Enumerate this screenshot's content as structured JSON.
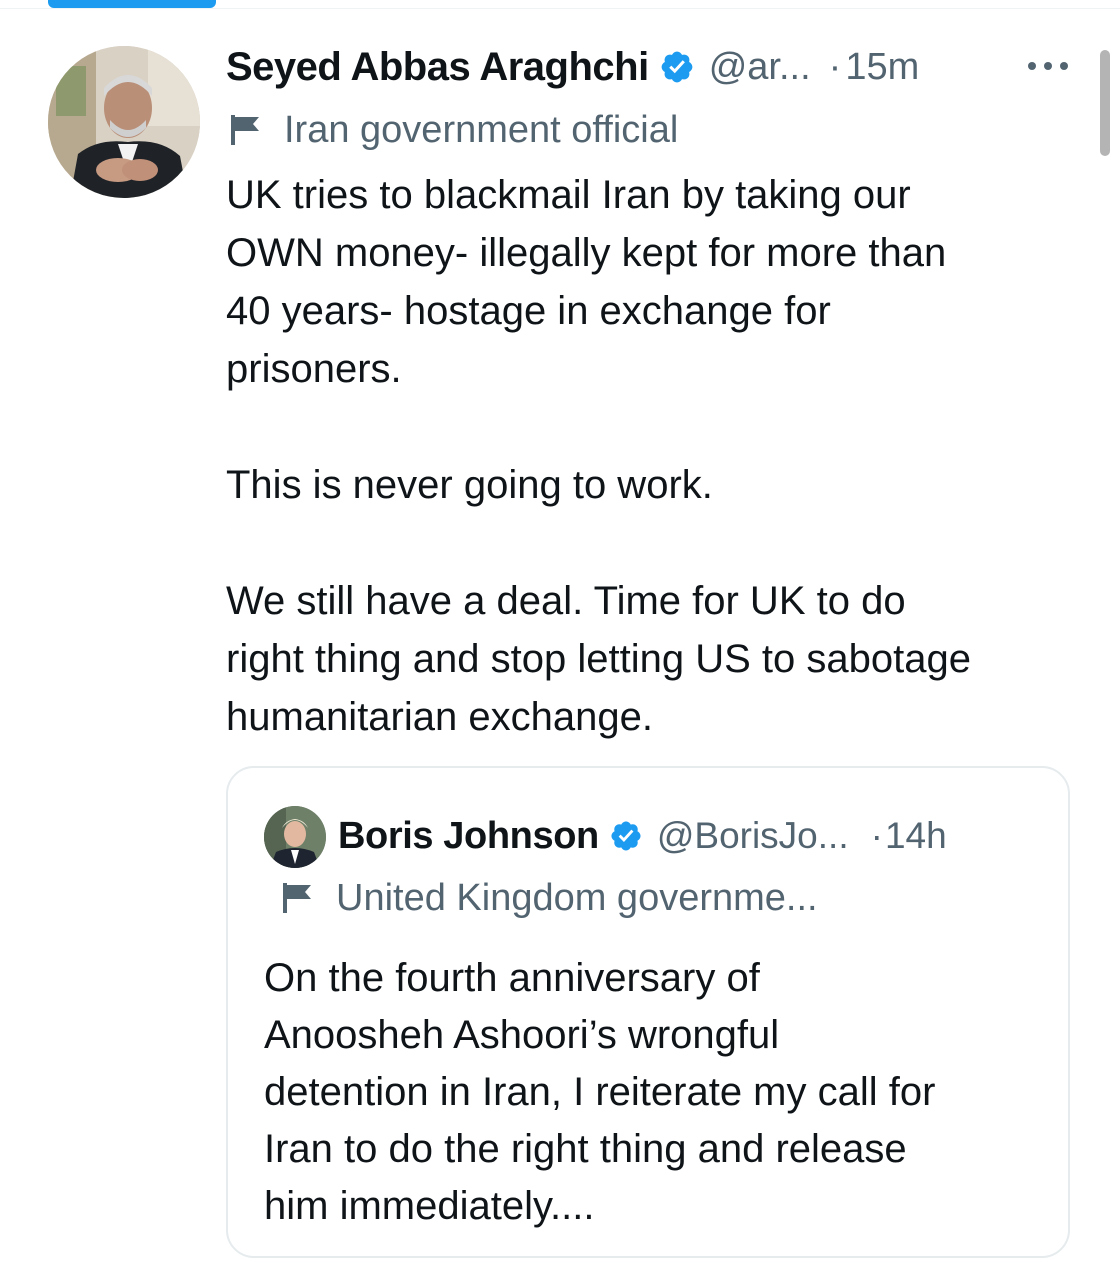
{
  "colors": {
    "accent": "#1d9bf0",
    "text_primary": "#0f1419",
    "text_secondary": "#536471",
    "border": "#e6ebee"
  },
  "tweet": {
    "display_name": "Seyed Abbas Araghchi",
    "handle": "@ar...",
    "separator": "·",
    "timestamp": "15m",
    "label": "Iran government official",
    "verified_icon": "verified-badge-icon",
    "flag_icon": "flag-icon",
    "more_icon": "more-options-icon",
    "paragraphs": [
      "UK tries to blackmail Iran by taking our OWN money- illegally kept for more than 40 years- hostage in exchange for prisoners.",
      "This is never going to work.",
      "We still have a deal. Time for UK to do right thing and stop letting US to sabotage humanitarian exchange."
    ],
    "lines": [
      "UK tries to blackmail Iran by taking our",
      "OWN money- illegally kept for more than",
      "40 years- hostage in exchange for",
      "prisoners.",
      "This is never going to work.",
      "We still have a deal. Time for UK to do",
      "right thing and stop letting US to sabotage",
      "humanitarian exchange."
    ]
  },
  "quoted_tweet": {
    "display_name": "Boris Johnson",
    "handle": "@BorisJo...",
    "separator": "·",
    "timestamp": "14h",
    "label": "United Kingdom governme...",
    "verified_icon": "verified-badge-icon",
    "flag_icon": "flag-icon",
    "lines": [
      "On the fourth anniversary of",
      "Anoosheh Ashoori’s wrongful",
      "detention in Iran, I reiterate my call for",
      "Iran to do the right thing and release",
      "him immediately...."
    ]
  }
}
